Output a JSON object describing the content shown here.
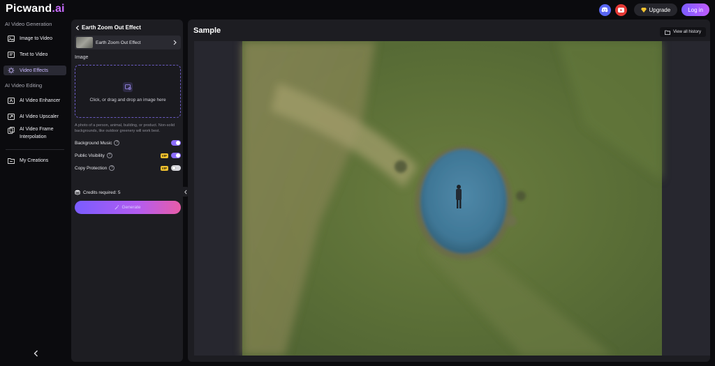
{
  "brand": {
    "name_main": "Picwand",
    "name_accent": ".ai"
  },
  "header": {
    "upgrade_label": "Upgrade",
    "login_label": "Log in"
  },
  "nav": {
    "section_generation": "AI Video Generation",
    "section_editing": "AI Video Editing",
    "items": [
      {
        "label": "Image to Video",
        "icon": "image-icon"
      },
      {
        "label": "Text to Video",
        "icon": "text-icon"
      },
      {
        "label": "Video Effects",
        "icon": "sparkle-icon",
        "active": true
      },
      {
        "label": "AI Video Enhancer",
        "icon": "enhance-icon"
      },
      {
        "label": "AI Video Upscaler",
        "icon": "upscale-icon"
      },
      {
        "label": "AI Video Frame",
        "label2": "Interpolation",
        "icon": "frame-icon"
      },
      {
        "label": "My Creations",
        "icon": "folder-icon"
      }
    ]
  },
  "panel": {
    "title": "Earth Zoom Out Effect",
    "effect_selected": "Earth Zoom Out Effect",
    "image_label": "Image",
    "dropzone_text": "Click, or drag and drop an image here",
    "hint": "A photo of a person, animal, building, or product. Non-solid backgrounds, like outdoor greenery will work best.",
    "toggles": [
      {
        "label": "Background Music",
        "on": true,
        "vip": false
      },
      {
        "label": "Public Visibility",
        "on": true,
        "vip": true
      },
      {
        "label": "Copy Protection",
        "on": false,
        "vip": true
      }
    ],
    "vip_badge": "VIP",
    "credits_text": "Credits required: 5",
    "generate_label": "Generate"
  },
  "sample": {
    "title": "Sample",
    "history_label": "View all history"
  },
  "colors": {
    "accent": "#8b6cff",
    "panel": "#1d1d22",
    "background": "#0b0b0e"
  }
}
